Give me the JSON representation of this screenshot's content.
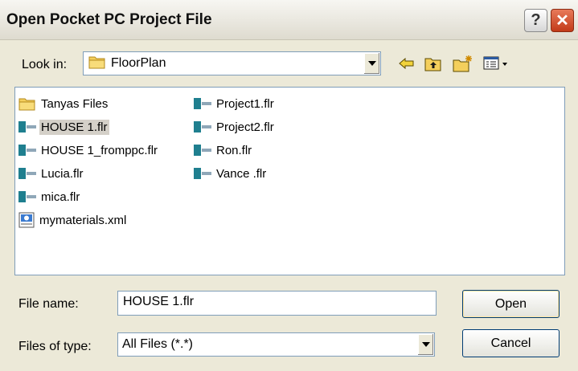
{
  "window": {
    "title": "Open Pocket PC Project File",
    "help_label": "?",
    "close_label": "✕"
  },
  "lookin": {
    "label": "Look in:",
    "value": "FloorPlan"
  },
  "toolbar": {
    "back_icon": "back-arrow-icon",
    "up_icon": "up-folder-icon",
    "new_folder_icon": "new-folder-icon",
    "views_icon": "view-menu-icon"
  },
  "files": [
    {
      "name": "Tanyas Files",
      "type": "folder",
      "selected": false
    },
    {
      "name": "HOUSE 1.flr",
      "type": "flr",
      "selected": true
    },
    {
      "name": "HOUSE 1_fromppc.flr",
      "type": "flr",
      "selected": false
    },
    {
      "name": "Lucia.flr",
      "type": "flr",
      "selected": false
    },
    {
      "name": "mica.flr",
      "type": "flr",
      "selected": false
    },
    {
      "name": "mymaterials.xml",
      "type": "xml",
      "selected": false
    },
    {
      "name": "Project1.flr",
      "type": "flr",
      "selected": false
    },
    {
      "name": "Project2.flr",
      "type": "flr",
      "selected": false
    },
    {
      "name": "Ron.flr",
      "type": "flr",
      "selected": false
    },
    {
      "name": "Vance .flr",
      "type": "flr",
      "selected": false
    }
  ],
  "filename": {
    "label": "File name:",
    "value": "HOUSE 1.flr"
  },
  "filetype": {
    "label": "Files of type:",
    "value": "All Files (*.*)"
  },
  "buttons": {
    "open": "Open",
    "cancel": "Cancel"
  },
  "colors": {
    "selection": "#d4d0c8",
    "close_button": "#c23a18",
    "flr_icon": "#1f7f8f",
    "folder": "#f4cf5c"
  }
}
